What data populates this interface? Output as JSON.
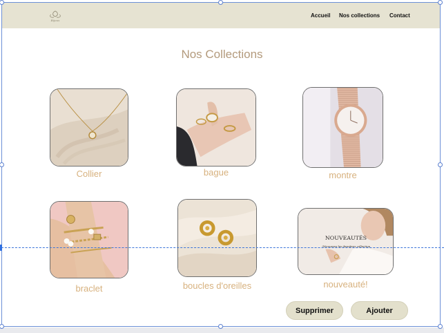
{
  "header": {
    "logo_text": "Bijoux",
    "nav": {
      "accueil": "Accueil",
      "collections": "Nos collections",
      "contact": "Contact"
    }
  },
  "main": {
    "title": "Nos Collections",
    "collections": [
      {
        "label": "Collier",
        "image": "necklace-photo"
      },
      {
        "label": "bague",
        "image": "rings-photo"
      },
      {
        "label": "montre",
        "image": "watch-photo"
      },
      {
        "label": "braclet",
        "image": "bracelets-photo"
      },
      {
        "label": "boucles d'oreilles",
        "image": "earrings-photo"
      },
      {
        "label": "nouveauté!",
        "image": "new-arrivals-photo",
        "overlay_title": "NOUVEAUTÉS",
        "overlay_subtitle": "-Découvrez les dernières collection"
      }
    ]
  },
  "actions": {
    "delete_label": "Supprimer",
    "add_label": "Ajouter"
  },
  "colors": {
    "header_bg": "#e6e3d2",
    "title": "#b39a7c",
    "label": "#d7b17e",
    "button_bg": "#e3e0cc"
  }
}
